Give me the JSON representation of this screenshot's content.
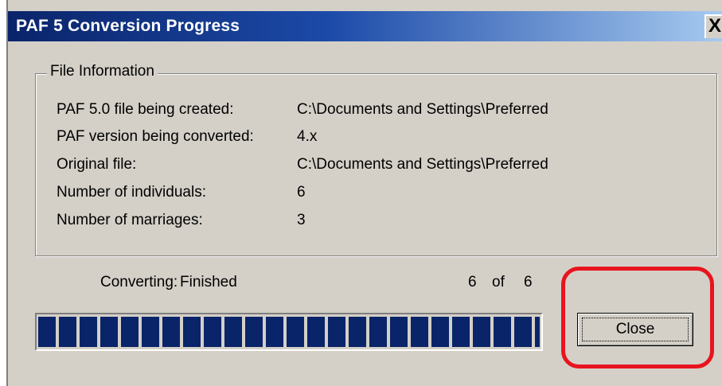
{
  "window": {
    "title": "PAF 5 Conversion Progress",
    "close_glyph": "X"
  },
  "file_info": {
    "legend": "File Information",
    "rows": [
      {
        "label": "PAF 5.0 file being created:",
        "value": "C:\\Documents and Settings\\Preferred"
      },
      {
        "label": "PAF version being converted:",
        "value": "4.x"
      },
      {
        "label": "Original file:",
        "value": "C:\\Documents and Settings\\Preferred"
      },
      {
        "label": "Number of individuals:",
        "value": "6"
      },
      {
        "label": "Number of marriages:",
        "value": "3"
      }
    ]
  },
  "status": {
    "label": "Converting:",
    "value": "Finished",
    "current": "6",
    "of": "of",
    "total": "6"
  },
  "progress": {
    "percent": 100,
    "fill_color": "#0a246a"
  },
  "close_button": {
    "label": "Close"
  },
  "highlight_color": "#e8141e"
}
